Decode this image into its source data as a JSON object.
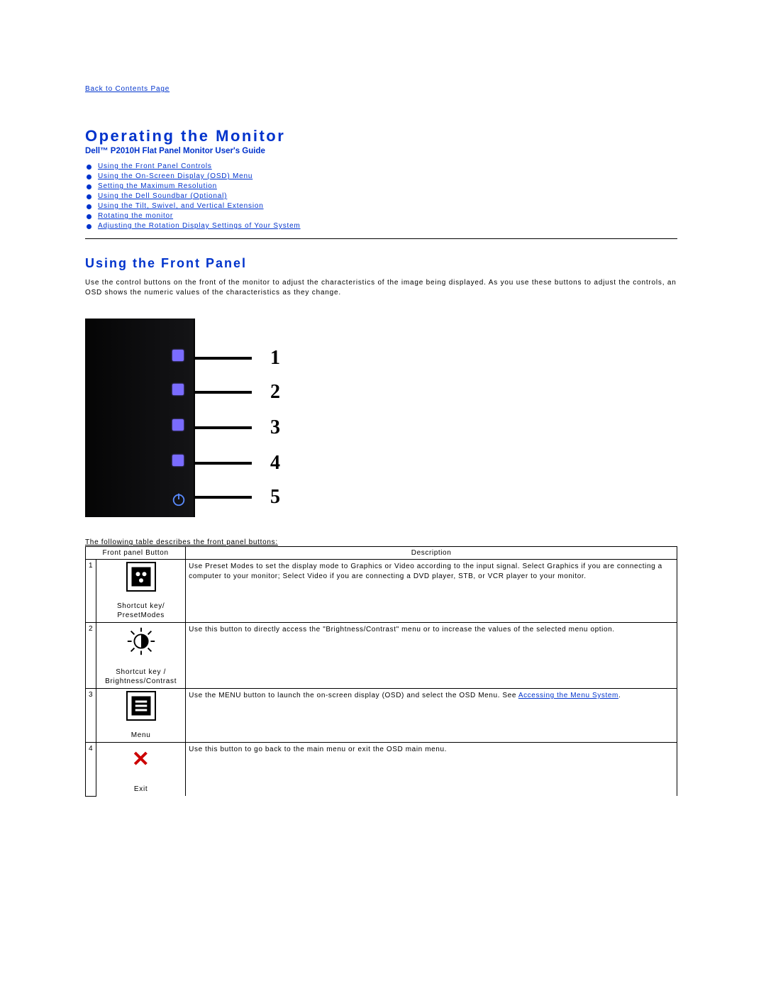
{
  "backLink": "Back to Contents Page",
  "title": "Operating the Monitor",
  "subtitle": "Dell™ P2010H Flat Panel Monitor User's Guide",
  "toc": [
    "Using the Front Panel Controls",
    "Using the On-Screen Display (OSD) Menu",
    "Setting the Maximum Resolution",
    "Using the Dell Soundbar (Optional)",
    "Using the Tilt, Swivel, and Vertical Extension",
    "Rotating the monitor",
    "Adjusting the Rotation Display Settings of Your System"
  ],
  "section1": {
    "heading": "Using the Front Panel",
    "intro": "Use the control buttons on the front of the monitor to adjust the characteristics of the image being displayed. As you use these buttons to adjust the controls, an OSD shows the numeric values of the characteristics as they change."
  },
  "figLabels": [
    "1",
    "2",
    "3",
    "4",
    "5"
  ],
  "preTable": "The following table describes the front panel buttons:",
  "tableHead": {
    "col1": "Front panel Button",
    "col2": "Description"
  },
  "rows": [
    {
      "num": "1",
      "label": "Shortcut key/ PresetModes",
      "desc_pre": "Use Preset Modes to set the display mode to Graphics or Video according to the input signal.\nSelect Graphics if you are connecting a computer to your monitor;\nSelect Video if you are connecting a DVD player, STB, or VCR player to your monitor.",
      "link": "",
      "desc_post": ""
    },
    {
      "num": "2",
      "label": "Shortcut key / Brightness/Contrast",
      "desc_pre": "Use this button to directly access the \"Brightness/Contrast\" menu or to increase the values of the selected menu option.",
      "link": "",
      "desc_post": ""
    },
    {
      "num": "3",
      "label": "Menu",
      "desc_pre": "Use the MENU button to launch the on-screen display (OSD) and select the OSD Menu. See ",
      "link": "Accessing the Menu System",
      "desc_post": "."
    },
    {
      "num": "4",
      "label": "Exit",
      "desc_pre": "Use this button to go back to the main menu or exit the OSD main menu.",
      "link": "",
      "desc_post": ""
    }
  ]
}
